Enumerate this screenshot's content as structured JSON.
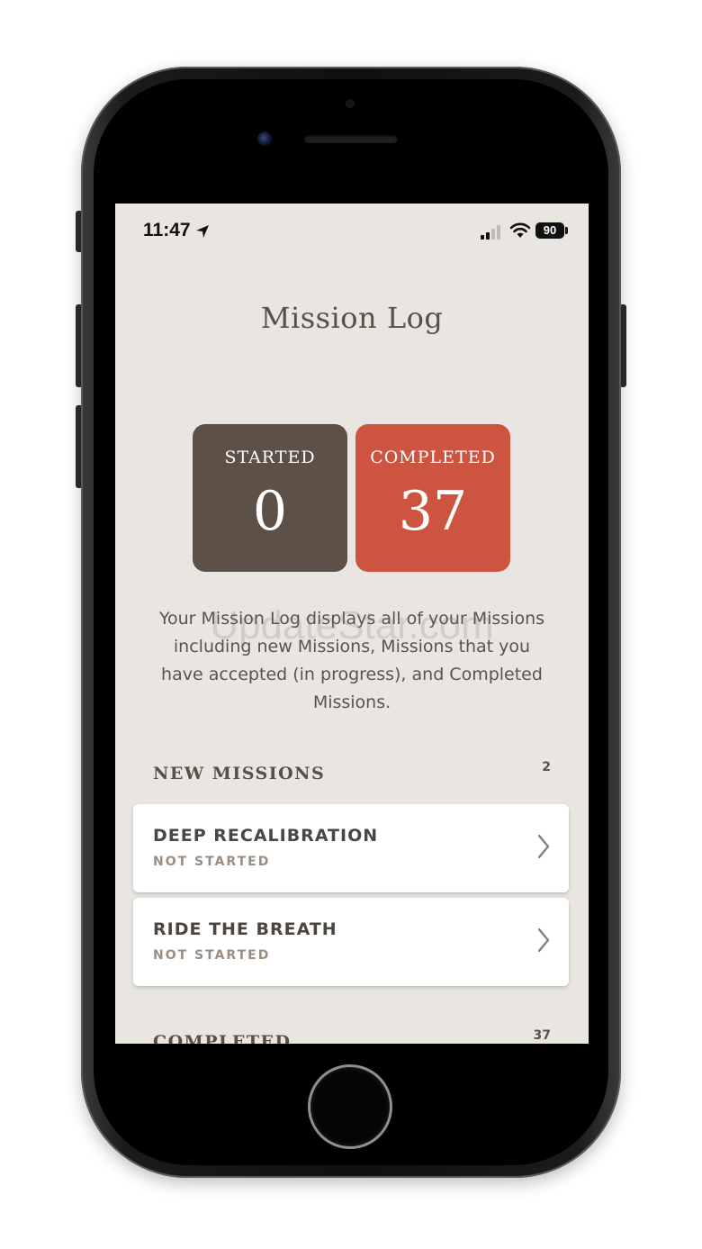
{
  "status_bar": {
    "time": "11:47",
    "battery": "90"
  },
  "mission_log": {
    "title": "Mission Log",
    "stats": {
      "started_label": "STARTED",
      "started_value": "0",
      "completed_label": "COMPLETED",
      "completed_value": "37"
    },
    "description": "Your Mission Log displays all of your Missions including new Missions, Missions that you have accepted (in progress), and Completed Missions.",
    "new_missions": {
      "title": "NEW MISSIONS",
      "count": "2",
      "items": [
        {
          "name": "DEEP RECALIBRATION",
          "status": "NOT STARTED"
        },
        {
          "name": "RIDE THE BREATH",
          "status": "NOT STARTED"
        }
      ]
    },
    "completed": {
      "title": "COMPLETED",
      "count": "37"
    }
  },
  "watermark": "UpdateStar.com",
  "colors": {
    "background": "#e9e6e2",
    "started_card": "#5c5047",
    "completed_card": "#cd5440",
    "text_primary": "#5a4f48",
    "text_muted": "#9a8e84"
  },
  "icons": [
    "location-arrow-icon",
    "signal-icon",
    "wifi-icon",
    "battery-icon",
    "chevron-right-icon"
  ]
}
